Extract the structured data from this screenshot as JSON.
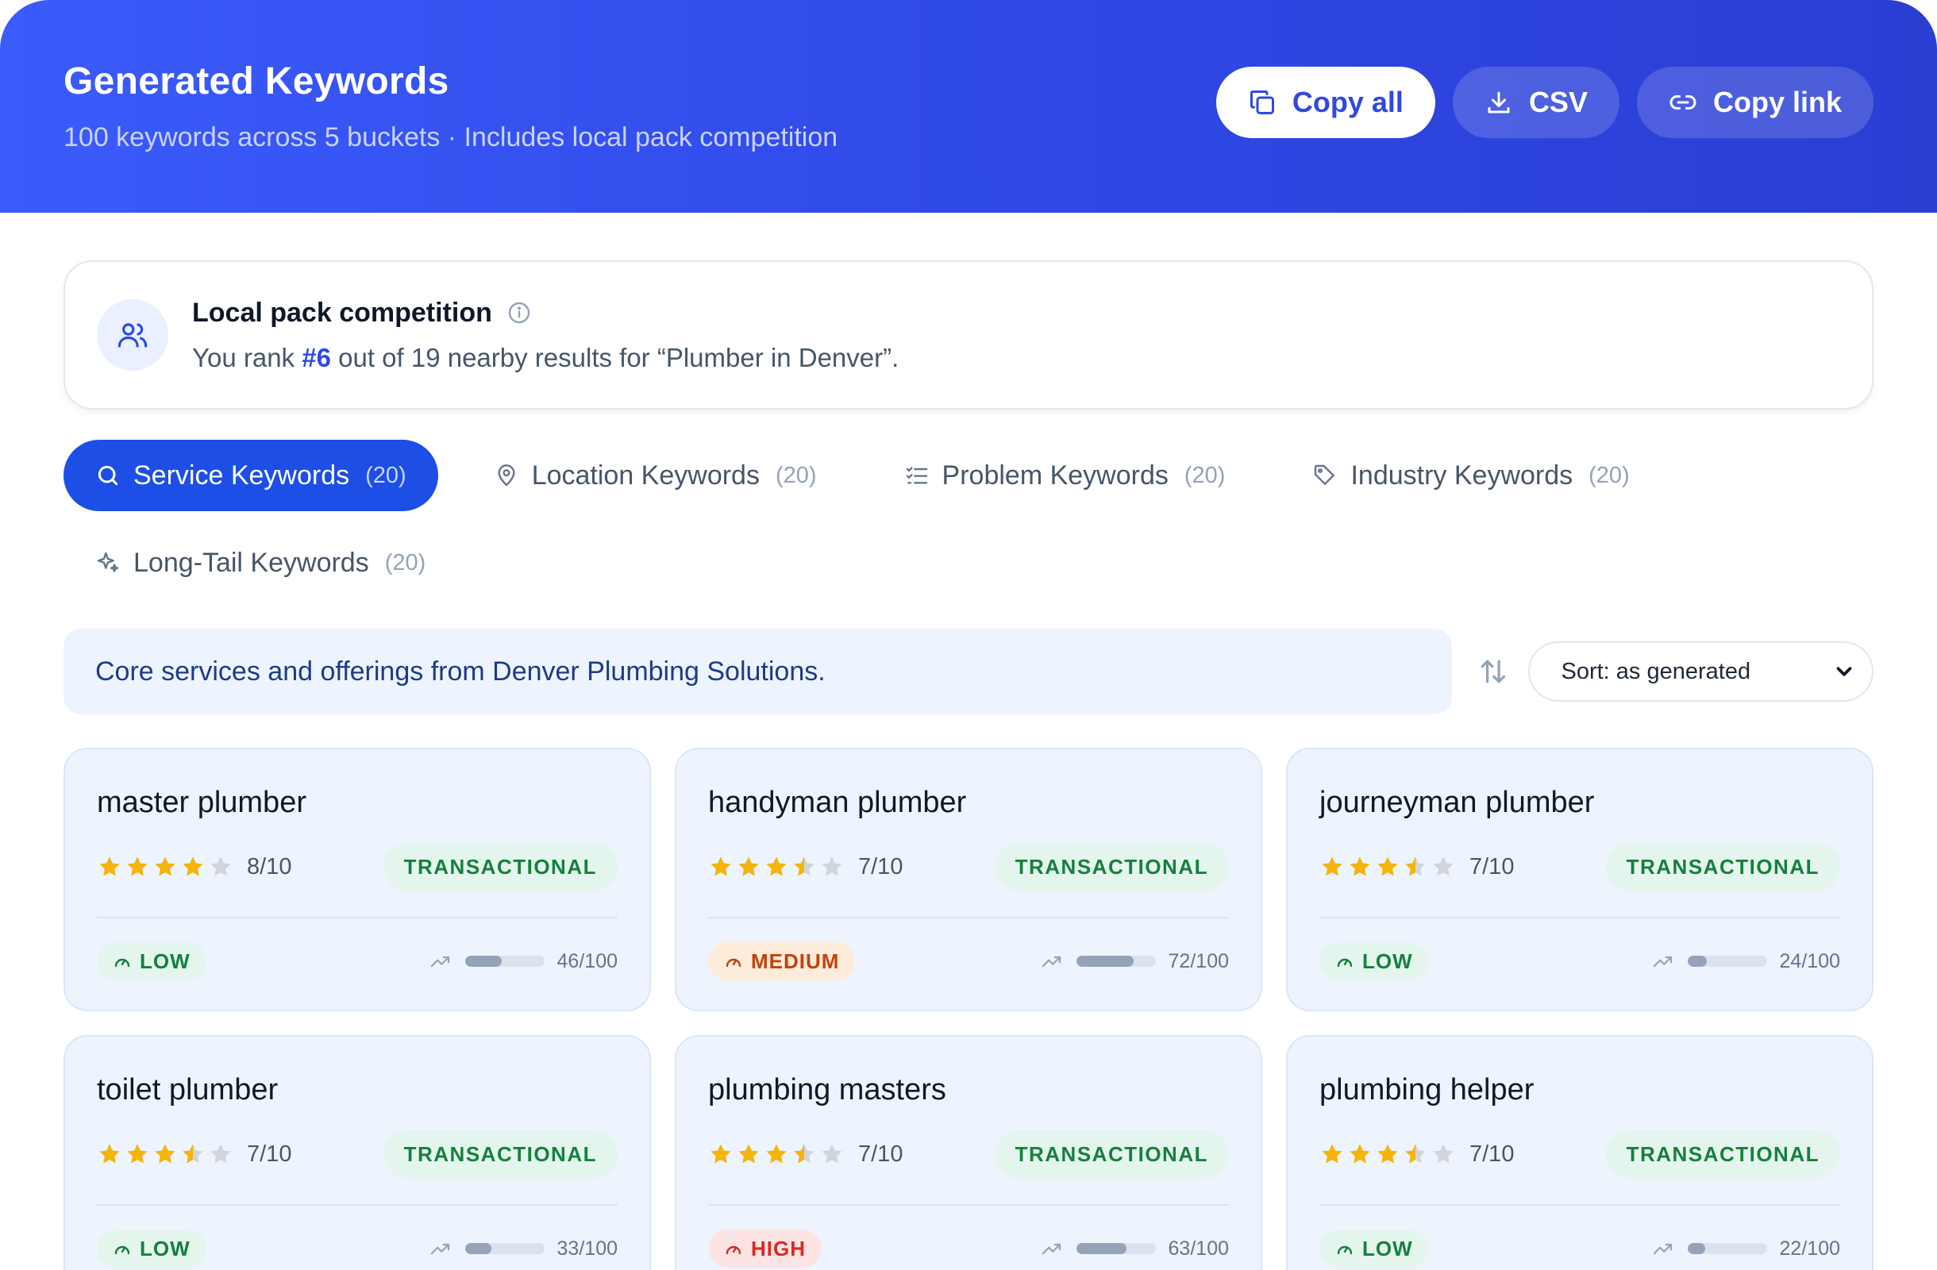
{
  "header": {
    "title": "Generated Keywords",
    "subtitle": "100 keywords across 5 buckets · Includes local pack competition",
    "actions": [
      {
        "label": "Copy all",
        "icon": "copy-icon"
      },
      {
        "label": "CSV",
        "icon": "download-icon"
      },
      {
        "label": "Copy link",
        "icon": "link-icon"
      }
    ]
  },
  "local_pack": {
    "title": "Local pack competition",
    "text_before": "You rank ",
    "rank": "#6",
    "text_after": " out of 19 nearby results for “Plumber in Denver”."
  },
  "tabs": [
    {
      "label": "Service Keywords",
      "count": "(20)",
      "icon": "search-icon",
      "active": true
    },
    {
      "label": "Location Keywords",
      "count": "(20)",
      "icon": "map-pin-icon",
      "active": false
    },
    {
      "label": "Problem Keywords",
      "count": "(20)",
      "icon": "checklist-icon",
      "active": false
    },
    {
      "label": "Industry Keywords",
      "count": "(20)",
      "icon": "tag-icon",
      "active": false
    },
    {
      "label": "Long-Tail Keywords",
      "count": "(20)",
      "icon": "sparkles-icon",
      "active": false
    }
  ],
  "description": "Core services and offerings from Denver Plumbing Solutions.",
  "sort": {
    "selected": "Sort: as generated"
  },
  "colors": {
    "accent": "#1d4fe6",
    "star": "#f5b40b",
    "star_empty": "#d1d5db"
  },
  "cards": [
    {
      "keyword": "master plumber",
      "rating": 4,
      "score": "8/10",
      "intent": "TRANSACTIONAL",
      "competition": "LOW",
      "level": "low",
      "volume": 46,
      "volume_label": "46/100"
    },
    {
      "keyword": "handyman plumber",
      "rating": 3.5,
      "score": "7/10",
      "intent": "TRANSACTIONAL",
      "competition": "MEDIUM",
      "level": "medium",
      "volume": 72,
      "volume_label": "72/100"
    },
    {
      "keyword": "journeyman plumber",
      "rating": 3.5,
      "score": "7/10",
      "intent": "TRANSACTIONAL",
      "competition": "LOW",
      "level": "low",
      "volume": 24,
      "volume_label": "24/100"
    },
    {
      "keyword": "toilet plumber",
      "rating": 3.5,
      "score": "7/10",
      "intent": "TRANSACTIONAL",
      "competition": "LOW",
      "level": "low",
      "volume": 33,
      "volume_label": "33/100"
    },
    {
      "keyword": "plumbing masters",
      "rating": 3.5,
      "score": "7/10",
      "intent": "TRANSACTIONAL",
      "competition": "HIGH",
      "level": "high",
      "volume": 63,
      "volume_label": "63/100"
    },
    {
      "keyword": "plumbing helper",
      "rating": 3.5,
      "score": "7/10",
      "intent": "TRANSACTIONAL",
      "competition": "LOW",
      "level": "low",
      "volume": 22,
      "volume_label": "22/100"
    }
  ]
}
